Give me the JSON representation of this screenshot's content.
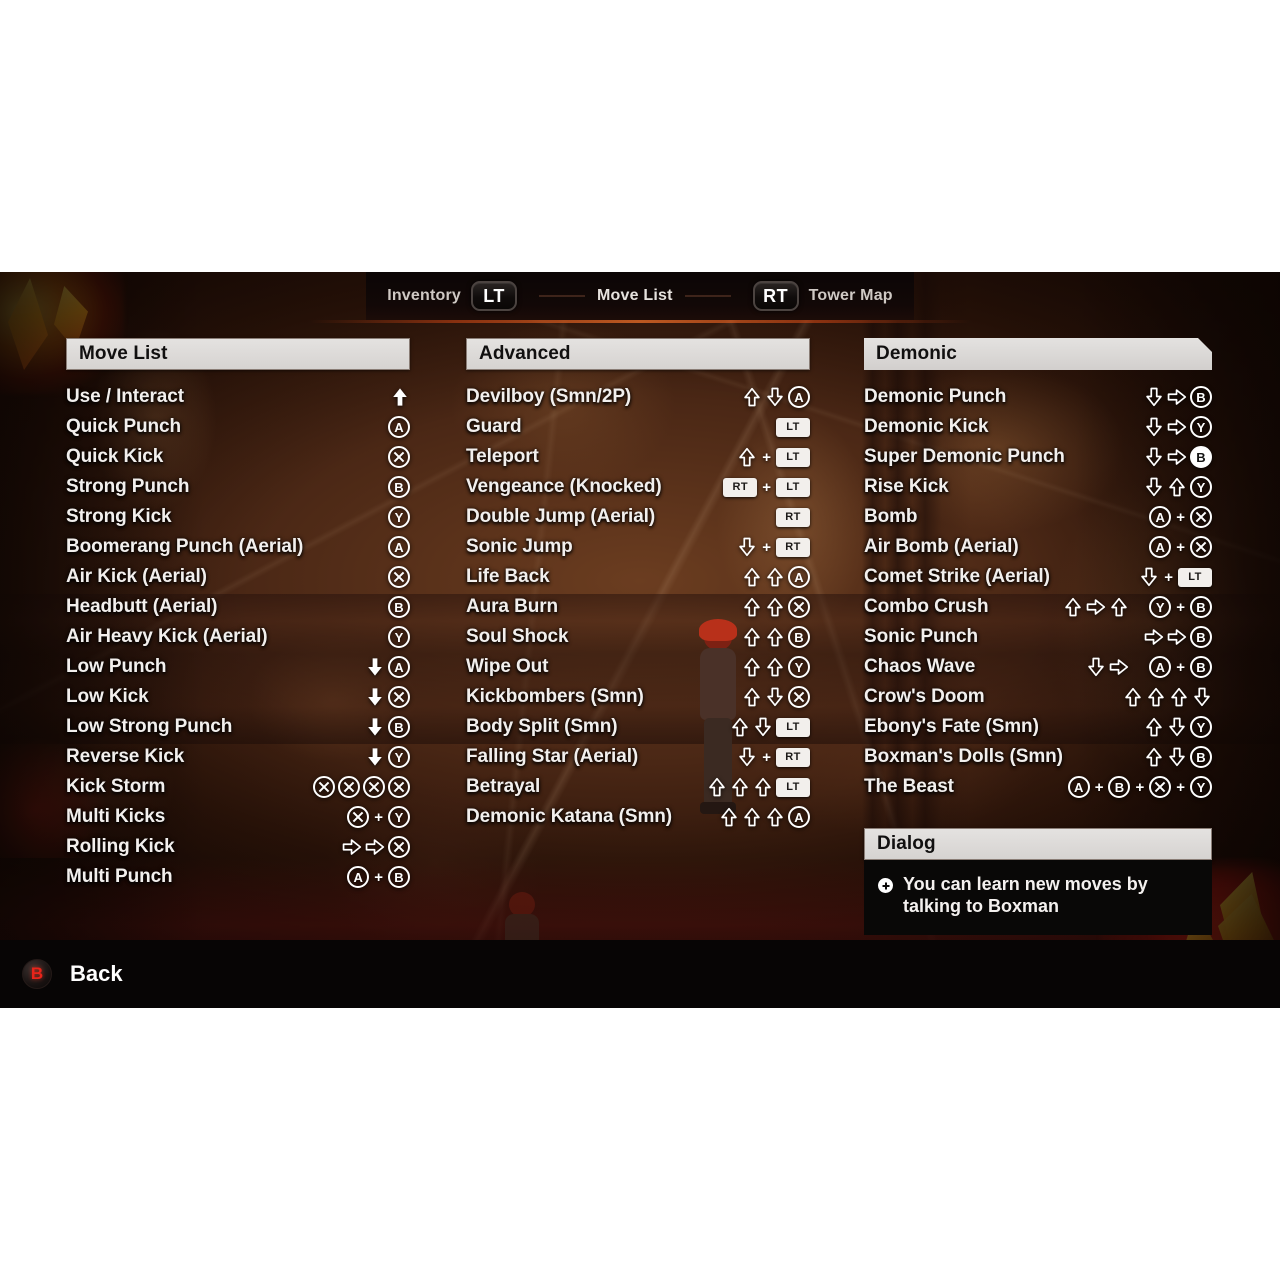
{
  "header": {
    "left_label": "Inventory",
    "left_trigger": "LT",
    "center_label": "Move List",
    "right_trigger": "RT",
    "right_label": "Tower Map"
  },
  "columns": [
    {
      "title": "Move List",
      "arrow_style": "solid",
      "rows": [
        {
          "label": "Use / Interact",
          "combo": [
            {
              "t": "arrow",
              "dir": "up",
              "style": "solid"
            }
          ]
        },
        {
          "label": "Quick Punch",
          "combo": [
            {
              "t": "btn",
              "v": "A"
            }
          ]
        },
        {
          "label": "Quick Kick",
          "combo": [
            {
              "t": "btn",
              "v": "X"
            }
          ]
        },
        {
          "label": "Strong Punch",
          "combo": [
            {
              "t": "btn",
              "v": "B"
            }
          ]
        },
        {
          "label": "Strong Kick",
          "combo": [
            {
              "t": "btn",
              "v": "Y"
            }
          ]
        },
        {
          "label": "Boomerang Punch (Aerial)",
          "combo": [
            {
              "t": "btn",
              "v": "A"
            }
          ]
        },
        {
          "label": "Air Kick (Aerial)",
          "combo": [
            {
              "t": "btn",
              "v": "X"
            }
          ]
        },
        {
          "label": "Headbutt (Aerial)",
          "combo": [
            {
              "t": "btn",
              "v": "B"
            }
          ]
        },
        {
          "label": "Air Heavy Kick (Aerial)",
          "combo": [
            {
              "t": "btn",
              "v": "Y"
            }
          ]
        },
        {
          "label": "Low Punch",
          "combo": [
            {
              "t": "arrow",
              "dir": "down",
              "style": "solid"
            },
            {
              "t": "btn",
              "v": "A"
            }
          ]
        },
        {
          "label": "Low Kick",
          "combo": [
            {
              "t": "arrow",
              "dir": "down",
              "style": "solid"
            },
            {
              "t": "btn",
              "v": "X"
            }
          ]
        },
        {
          "label": "Low Strong Punch",
          "combo": [
            {
              "t": "arrow",
              "dir": "down",
              "style": "solid"
            },
            {
              "t": "btn",
              "v": "B"
            }
          ]
        },
        {
          "label": "Reverse Kick",
          "combo": [
            {
              "t": "arrow",
              "dir": "down",
              "style": "solid"
            },
            {
              "t": "btn",
              "v": "Y"
            }
          ]
        },
        {
          "label": "Kick Storm",
          "combo": [
            {
              "t": "btn",
              "v": "X"
            },
            {
              "t": "btn",
              "v": "X"
            },
            {
              "t": "btn",
              "v": "X"
            },
            {
              "t": "btn",
              "v": "X"
            }
          ]
        },
        {
          "label": "Multi Kicks",
          "combo": [
            {
              "t": "btn",
              "v": "X"
            },
            {
              "t": "plus",
              "v": "+"
            },
            {
              "t": "btn",
              "v": "Y"
            }
          ]
        },
        {
          "label": "Rolling Kick",
          "combo": [
            {
              "t": "arrow",
              "dir": "right",
              "style": "hollow"
            },
            {
              "t": "arrow",
              "dir": "right",
              "style": "hollow"
            },
            {
              "t": "btn",
              "v": "X"
            }
          ]
        },
        {
          "label": "Multi Punch",
          "combo": [
            {
              "t": "btn",
              "v": "A"
            },
            {
              "t": "plus",
              "v": "+"
            },
            {
              "t": "btn",
              "v": "B"
            }
          ]
        }
      ]
    },
    {
      "title": "Advanced",
      "arrow_style": "hollow",
      "rows": [
        {
          "label": "Devilboy (Smn/2P)",
          "combo": [
            {
              "t": "arrow",
              "dir": "up",
              "style": "hollow"
            },
            {
              "t": "arrow",
              "dir": "down",
              "style": "hollow"
            },
            {
              "t": "btn",
              "v": "A"
            }
          ]
        },
        {
          "label": "Guard",
          "combo": [
            {
              "t": "trig",
              "v": "LT"
            }
          ]
        },
        {
          "label": "Teleport",
          "combo": [
            {
              "t": "arrow",
              "dir": "up",
              "style": "hollow"
            },
            {
              "t": "plus",
              "v": "+"
            },
            {
              "t": "trig",
              "v": "LT"
            }
          ]
        },
        {
          "label": "Vengeance (Knocked)",
          "combo": [
            {
              "t": "trig",
              "v": "RT"
            },
            {
              "t": "plus",
              "v": "+"
            },
            {
              "t": "trig",
              "v": "LT"
            }
          ]
        },
        {
          "label": "Double Jump (Aerial)",
          "combo": [
            {
              "t": "trig",
              "v": "RT"
            }
          ]
        },
        {
          "label": "Sonic Jump",
          "combo": [
            {
              "t": "arrow",
              "dir": "down",
              "style": "hollow"
            },
            {
              "t": "plus",
              "v": "+"
            },
            {
              "t": "trig",
              "v": "RT"
            }
          ]
        },
        {
          "label": "Life Back",
          "combo": [
            {
              "t": "arrow",
              "dir": "up",
              "style": "hollow"
            },
            {
              "t": "arrow",
              "dir": "up",
              "style": "hollow"
            },
            {
              "t": "btn",
              "v": "A"
            }
          ]
        },
        {
          "label": "Aura Burn",
          "combo": [
            {
              "t": "arrow",
              "dir": "up",
              "style": "hollow"
            },
            {
              "t": "arrow",
              "dir": "up",
              "style": "hollow"
            },
            {
              "t": "btn",
              "v": "X"
            }
          ]
        },
        {
          "label": "Soul Shock",
          "combo": [
            {
              "t": "arrow",
              "dir": "up",
              "style": "hollow"
            },
            {
              "t": "arrow",
              "dir": "up",
              "style": "hollow"
            },
            {
              "t": "btn",
              "v": "B"
            }
          ]
        },
        {
          "label": "Wipe Out",
          "combo": [
            {
              "t": "arrow",
              "dir": "up",
              "style": "hollow"
            },
            {
              "t": "arrow",
              "dir": "up",
              "style": "hollow"
            },
            {
              "t": "btn",
              "v": "Y"
            }
          ]
        },
        {
          "label": "Kickbombers (Smn)",
          "combo": [
            {
              "t": "arrow",
              "dir": "up",
              "style": "hollow"
            },
            {
              "t": "arrow",
              "dir": "down",
              "style": "hollow"
            },
            {
              "t": "btn",
              "v": "X"
            }
          ]
        },
        {
          "label": "Body Split (Smn)",
          "combo": [
            {
              "t": "arrow",
              "dir": "up",
              "style": "hollow"
            },
            {
              "t": "arrow",
              "dir": "down",
              "style": "hollow"
            },
            {
              "t": "trig",
              "v": "LT"
            }
          ]
        },
        {
          "label": "Falling Star (Aerial)",
          "combo": [
            {
              "t": "arrow",
              "dir": "down",
              "style": "hollow"
            },
            {
              "t": "plus",
              "v": "+"
            },
            {
              "t": "trig",
              "v": "RT"
            }
          ]
        },
        {
          "label": "Betrayal",
          "combo": [
            {
              "t": "arrow",
              "dir": "up",
              "style": "hollow"
            },
            {
              "t": "arrow",
              "dir": "up",
              "style": "hollow"
            },
            {
              "t": "arrow",
              "dir": "up",
              "style": "hollow"
            },
            {
              "t": "trig",
              "v": "LT"
            }
          ]
        },
        {
          "label": "Demonic Katana (Smn)",
          "combo": [
            {
              "t": "arrow",
              "dir": "up",
              "style": "hollow"
            },
            {
              "t": "arrow",
              "dir": "up",
              "style": "hollow"
            },
            {
              "t": "arrow",
              "dir": "up",
              "style": "hollow"
            },
            {
              "t": "btn",
              "v": "A"
            }
          ]
        }
      ]
    },
    {
      "title": "Demonic",
      "arrow_style": "hollow",
      "rows": [
        {
          "label": "Demonic Punch",
          "combo": [
            {
              "t": "arrow",
              "dir": "down",
              "style": "hollow"
            },
            {
              "t": "arrow",
              "dir": "right",
              "style": "hollow"
            },
            {
              "t": "btn",
              "v": "B"
            }
          ]
        },
        {
          "label": "Demonic Kick",
          "combo": [
            {
              "t": "arrow",
              "dir": "down",
              "style": "hollow"
            },
            {
              "t": "arrow",
              "dir": "right",
              "style": "hollow"
            },
            {
              "t": "btn",
              "v": "Y"
            }
          ]
        },
        {
          "label": "Super Demonic Punch",
          "combo": [
            {
              "t": "arrow",
              "dir": "down",
              "style": "hollow"
            },
            {
              "t": "arrow",
              "dir": "right",
              "style": "hollow"
            },
            {
              "t": "btn",
              "v": "B",
              "filled": true
            }
          ]
        },
        {
          "label": "Rise Kick",
          "combo": [
            {
              "t": "arrow",
              "dir": "down",
              "style": "hollow"
            },
            {
              "t": "arrow",
              "dir": "up",
              "style": "hollow"
            },
            {
              "t": "btn",
              "v": "Y"
            }
          ]
        },
        {
          "label": "Bomb",
          "combo": [
            {
              "t": "btn",
              "v": "A"
            },
            {
              "t": "plus",
              "v": "+"
            },
            {
              "t": "btn",
              "v": "X"
            }
          ]
        },
        {
          "label": "Air Bomb (Aerial)",
          "combo": [
            {
              "t": "btn",
              "v": "A"
            },
            {
              "t": "plus",
              "v": "+"
            },
            {
              "t": "btn",
              "v": "X"
            }
          ]
        },
        {
          "label": "Comet Strike (Aerial)",
          "combo": [
            {
              "t": "arrow",
              "dir": "down",
              "style": "hollow"
            },
            {
              "t": "plus",
              "v": "+"
            },
            {
              "t": "trig",
              "v": "LT"
            }
          ]
        },
        {
          "label": "Combo Crush",
          "combo": [
            {
              "t": "arrow",
              "dir": "up",
              "style": "hollow"
            },
            {
              "t": "arrow",
              "dir": "right",
              "style": "hollow"
            },
            {
              "t": "arrow",
              "dir": "up",
              "style": "hollow"
            },
            {
              "t": "gap"
            },
            {
              "t": "btn",
              "v": "Y"
            },
            {
              "t": "plus",
              "v": "+"
            },
            {
              "t": "btn",
              "v": "B"
            }
          ]
        },
        {
          "label": "Sonic Punch",
          "combo": [
            {
              "t": "arrow",
              "dir": "right",
              "style": "hollow"
            },
            {
              "t": "arrow",
              "dir": "right",
              "style": "hollow"
            },
            {
              "t": "btn",
              "v": "B"
            }
          ]
        },
        {
          "label": "Chaos Wave",
          "combo": [
            {
              "t": "arrow",
              "dir": "down",
              "style": "hollow"
            },
            {
              "t": "arrow",
              "dir": "right",
              "style": "hollow"
            },
            {
              "t": "gap"
            },
            {
              "t": "btn",
              "v": "A"
            },
            {
              "t": "plus",
              "v": "+"
            },
            {
              "t": "btn",
              "v": "B"
            }
          ]
        },
        {
          "label": "Crow's Doom",
          "combo": [
            {
              "t": "arrow",
              "dir": "up",
              "style": "hollow"
            },
            {
              "t": "arrow",
              "dir": "up",
              "style": "hollow"
            },
            {
              "t": "arrow",
              "dir": "up",
              "style": "hollow"
            },
            {
              "t": "arrow",
              "dir": "down",
              "style": "hollow"
            }
          ]
        },
        {
          "label": "Ebony's Fate (Smn)",
          "combo": [
            {
              "t": "arrow",
              "dir": "up",
              "style": "hollow"
            },
            {
              "t": "arrow",
              "dir": "down",
              "style": "hollow"
            },
            {
              "t": "btn",
              "v": "Y"
            }
          ]
        },
        {
          "label": "Boxman's Dolls (Smn)",
          "combo": [
            {
              "t": "arrow",
              "dir": "up",
              "style": "hollow"
            },
            {
              "t": "arrow",
              "dir": "down",
              "style": "hollow"
            },
            {
              "t": "btn",
              "v": "B"
            }
          ]
        },
        {
          "label": "The Beast",
          "combo": [
            {
              "t": "btn",
              "v": "A"
            },
            {
              "t": "plus",
              "v": "+"
            },
            {
              "t": "btn",
              "v": "B"
            },
            {
              "t": "plus",
              "v": "+"
            },
            {
              "t": "btn",
              "v": "X"
            },
            {
              "t": "plus",
              "v": "+"
            },
            {
              "t": "btn",
              "v": "Y"
            }
          ]
        }
      ]
    }
  ],
  "dialog": {
    "title": "Dialog",
    "bullet_icon": "plus-circle-icon",
    "message": "You can learn new moves by talking to Boxman"
  },
  "footer": {
    "back_button_glyph": "B",
    "back_label": "Back"
  },
  "colors": {
    "panel_header_bg": "#dcd9d7",
    "panel_header_text": "#111010",
    "row_text": "#f2efed",
    "accent_red": "#e8241a",
    "dialog_bg": "#090807",
    "bar_bg": "#070505"
  }
}
